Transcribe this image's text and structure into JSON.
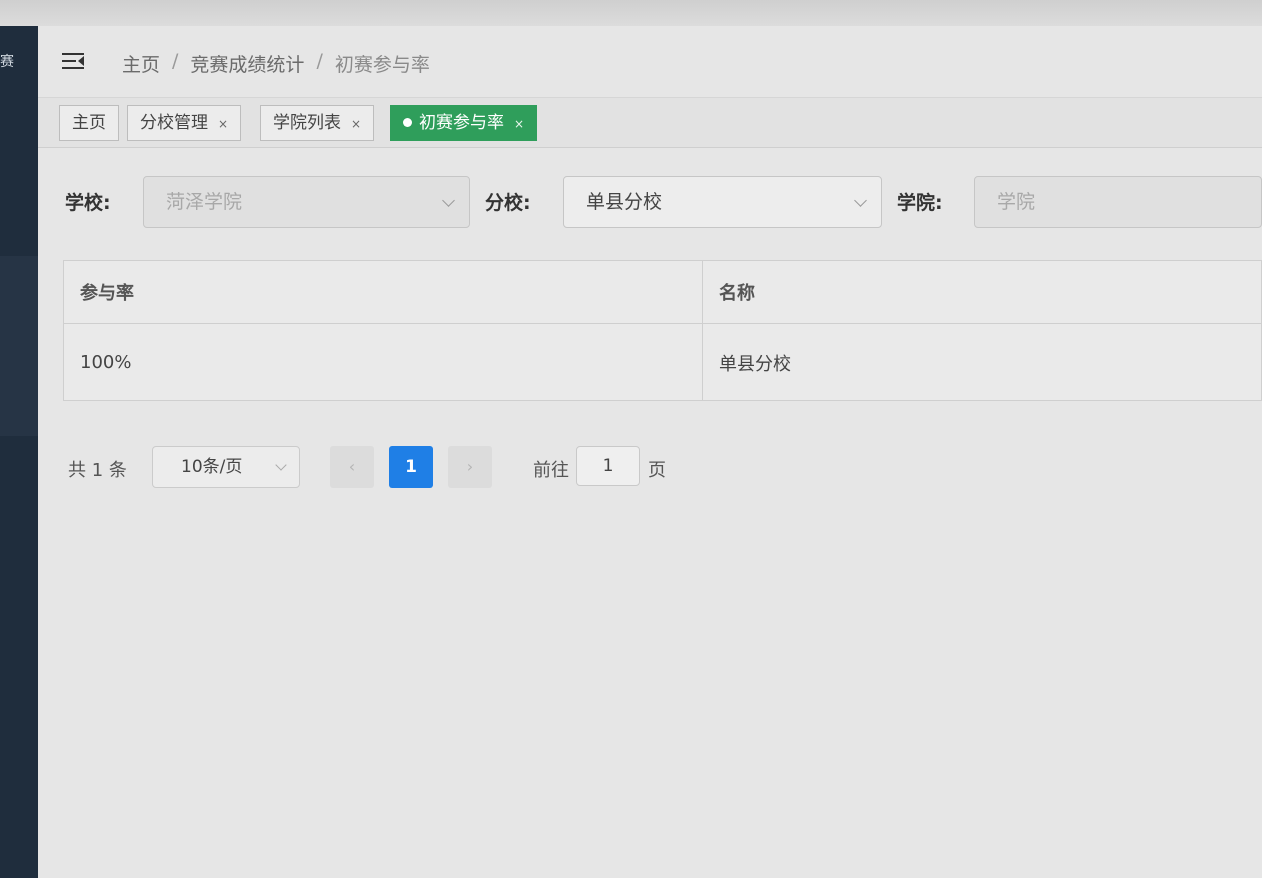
{
  "sidebar": {
    "glyph": "赛"
  },
  "navbar": {
    "menu_icon": "hamburger-icon",
    "breadcrumb": [
      "主页",
      "竞赛成绩统计",
      "初赛参与率"
    ],
    "separator": "/"
  },
  "tags": [
    {
      "label": "主页",
      "closable": false,
      "active": false
    },
    {
      "label": "分校管理",
      "closable": true,
      "active": false
    },
    {
      "label": "学院列表",
      "closable": true,
      "active": false
    },
    {
      "label": "初赛参与率",
      "closable": true,
      "active": true
    }
  ],
  "tag_close": "×",
  "filters": {
    "school_label": "学校:",
    "school_value": "菏泽学院",
    "branch_label": "分校:",
    "branch_value": "单县分校",
    "college_label": "学院:",
    "college_placeholder": "学院"
  },
  "table": {
    "headers": [
      "参与率",
      "名称"
    ],
    "rows": [
      [
        "100%",
        "单县分校"
      ]
    ]
  },
  "pagination": {
    "total": "共 1 条",
    "page_size": "10条/页",
    "prev": "‹",
    "current_page": "1",
    "next": "›",
    "goto_label": "前往",
    "goto_value": "1",
    "goto_unit": "页"
  },
  "colors": {
    "active_tag": "#2f9e5b",
    "current_page": "#1f7fe6",
    "sidebar": "#1f2d3d"
  }
}
